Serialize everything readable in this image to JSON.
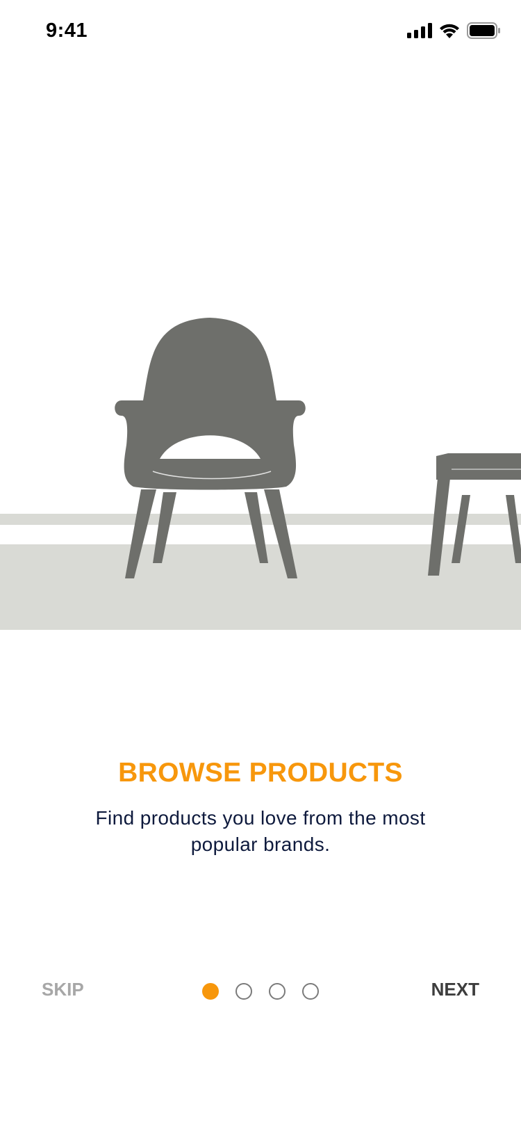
{
  "status_bar": {
    "time": "9:41",
    "icons": [
      "signal-icon",
      "wifi-icon",
      "battery-icon"
    ]
  },
  "illustration": {
    "subject": "chair-and-side-table-icon",
    "colors": {
      "furniture": "#6e6f6b",
      "floor": "#d9dad5"
    }
  },
  "onboarding": {
    "title": "BROWSE PRODUCTS",
    "description": "Find products you love from the most popular brands.",
    "accent_color": "#f7970c",
    "current_page": 1,
    "total_pages": 4
  },
  "nav": {
    "skip_label": "SKIP",
    "next_label": "NEXT"
  }
}
